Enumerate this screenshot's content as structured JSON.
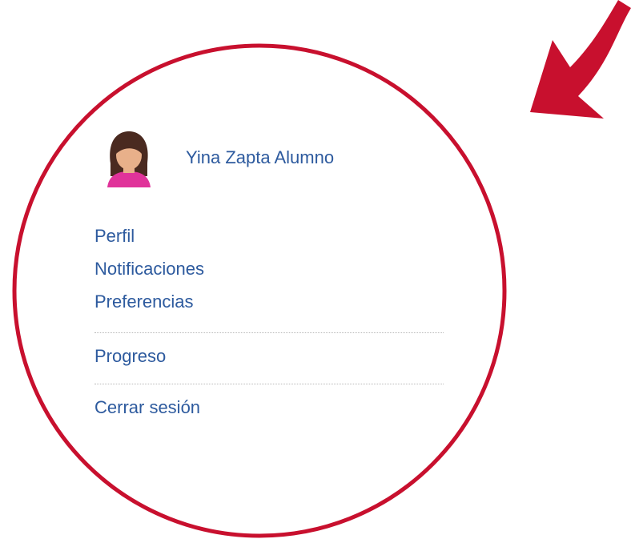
{
  "user": {
    "name": "Yina Zapta Alumno",
    "avatar_icon": "female-user-avatar-icon"
  },
  "menu": {
    "items_group1": [
      "Perfil",
      "Notificaciones",
      "Preferencias"
    ],
    "item_progress": "Progreso",
    "item_logout": "Cerrar sesión"
  },
  "annotation": {
    "circle_color": "#c8102e",
    "arrow_icon": "curved-arrow-icon"
  },
  "link_color": "#2d5a9e"
}
